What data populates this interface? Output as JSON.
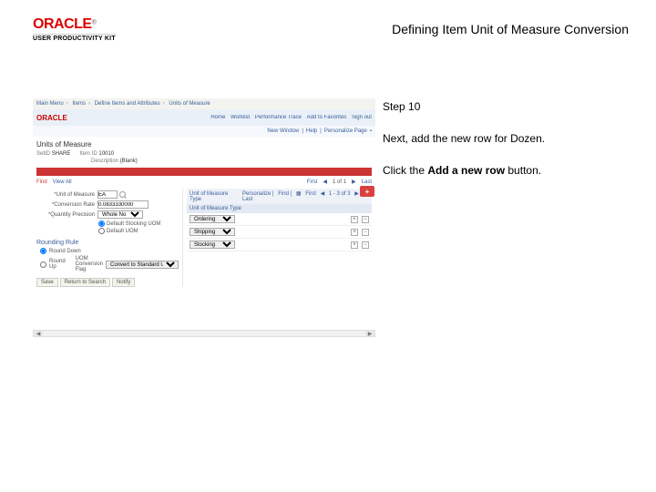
{
  "logo": {
    "brand": "ORACLE",
    "tm": "®",
    "product": "USER PRODUCTIVITY KIT"
  },
  "page_title": "Defining Item Unit of Measure Conversion",
  "step": {
    "heading": "Step 10",
    "line1": "Next, add the new row for Dozen.",
    "line2a": "Click the ",
    "line2b": "Add a new row",
    "line2c": " button."
  },
  "app": {
    "breadcrumb": [
      "Main Menu",
      "Items",
      "Define Items and Attributes",
      "Units of Measure"
    ],
    "topbar_brand": "ORACLE",
    "top_links": [
      "Home",
      "Worklist",
      "Performance Trace",
      "Add to Favorites",
      "Sign out"
    ],
    "util_links": [
      "New Window",
      "Help",
      "Personalize Page"
    ],
    "section_title": "Units of Measure",
    "setid": {
      "label": "SetID",
      "value": "SHARE"
    },
    "itemid": {
      "label": "Item ID",
      "value": "10010"
    },
    "desc": {
      "label": "Description",
      "value": "(Blank)"
    },
    "redbar_text": "",
    "findrow": {
      "find": "Find",
      "view_all": "View All",
      "first": "First",
      "nav": "1 of 1",
      "last": "Last"
    },
    "form": {
      "uom_label": "*Unit of Measure",
      "uom_value": "EA",
      "convrate_label": "*Conversion Rate",
      "convrate_value": "0.0833330000",
      "qtyprec_label": "*Quantity Precision",
      "qtyprec_value": "Whole No",
      "radio1": "Default Stocking UOM",
      "radio2": "Default UOM"
    },
    "grid": {
      "header_left": "Unit of Measure Type",
      "header_sub": "Unit of Measure Type",
      "tools": {
        "personalize": "Personalize",
        "find": "Find",
        "first": "First",
        "nav": "1 - 3 of 3",
        "last": "Last"
      },
      "rows": [
        {
          "value": "Ordering"
        },
        {
          "value": "Shipping"
        },
        {
          "value": "Stocking"
        }
      ],
      "plus": "+",
      "minus": "−",
      "highlight": "+"
    },
    "rounding": {
      "title": "Rounding Rule",
      "opt1": "Round Down",
      "opt2": "Round Up",
      "opt2_field_label": "UOM Conversion Flag",
      "opt2_field_value": "Convert to Standard UOM"
    },
    "footer": {
      "save": "Save",
      "return": "Return to Search",
      "notify": "Notify"
    }
  }
}
